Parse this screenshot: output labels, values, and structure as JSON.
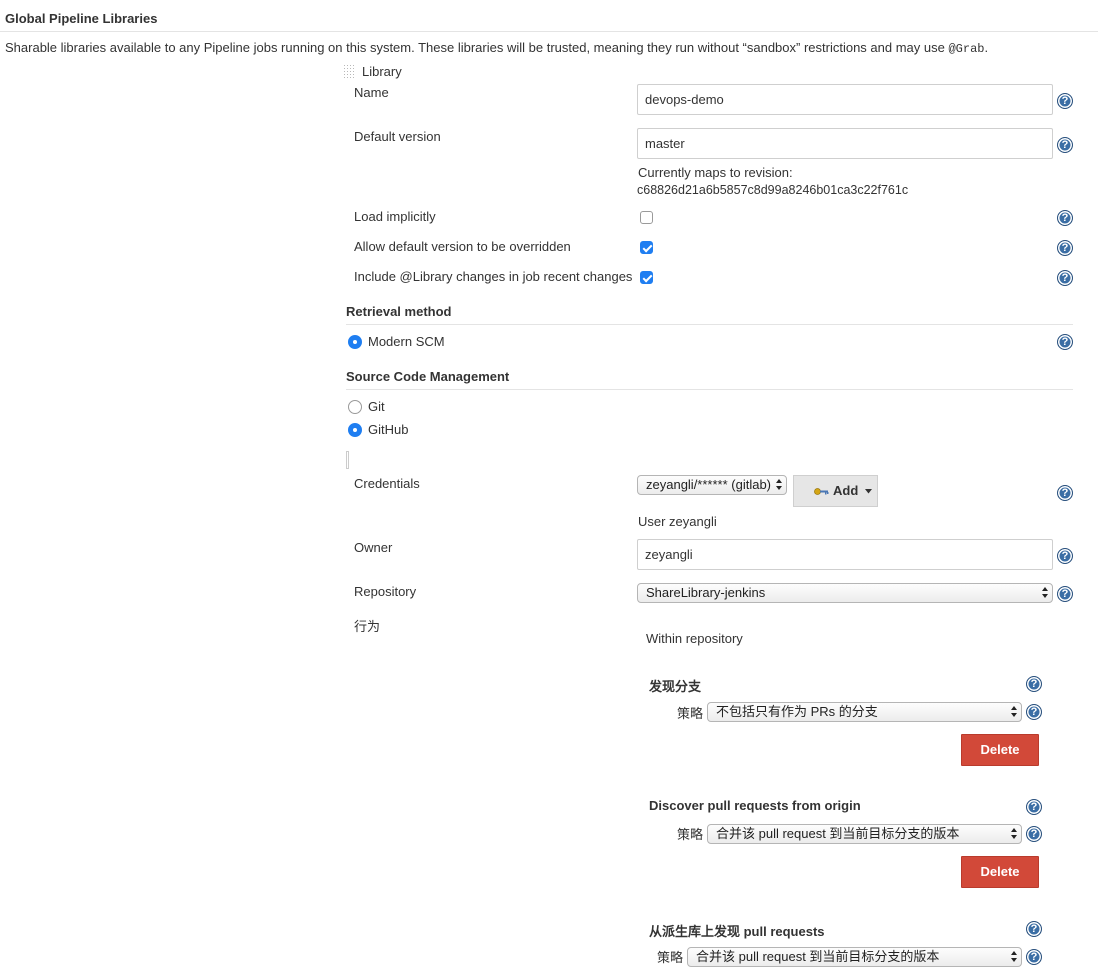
{
  "header": {
    "title": "Global Pipeline Libraries",
    "description_main": "Sharable libraries available to any Pipeline jobs running on this system. These libraries will be trusted, meaning they run without “sandbox” restrictions and may use ",
    "description_code": "@Grab",
    "description_end": "."
  },
  "library": {
    "header_label": "Library",
    "name": {
      "label": "Name",
      "value": "devops-demo"
    },
    "default_version": {
      "label": "Default version",
      "value": "master",
      "revision_label": "Currently maps to revision:",
      "revision": "c68826d21a6b5857c8d99a8246b01ca3c22f761c"
    },
    "load_implicitly": {
      "label": "Load implicitly",
      "checked": false
    },
    "allow_override": {
      "label": "Allow default version to be overridden",
      "checked": true
    },
    "include_changes": {
      "label": "Include @Library changes in job recent changes",
      "checked": true
    }
  },
  "retrieval": {
    "title": "Retrieval method",
    "option": "Modern SCM"
  },
  "scm": {
    "title": "Source Code Management",
    "git": "Git",
    "github": "GitHub",
    "credentials": {
      "label": "Credentials",
      "selected": "zeyangli/****** (gitlab)",
      "add_label": "Add",
      "user_text": "User zeyangli"
    },
    "owner": {
      "label": "Owner",
      "value": "zeyangli"
    },
    "repository": {
      "label": "Repository",
      "selected": "ShareLibrary-jenkins"
    },
    "behaviors": {
      "label": "行为",
      "within": "Within repository",
      "items": [
        {
          "title": "发现分支",
          "strategy_label": "策略",
          "strategy": "不包括只有作为 PRs 的分支",
          "delete": "Delete"
        },
        {
          "title": "Discover pull requests from origin",
          "strategy_label": "策略",
          "strategy": "合并该 pull request 到当前目标分支的版本",
          "delete": "Delete"
        },
        {
          "title": "从派生库上发现 pull requests",
          "strategy_label": "策略",
          "strategy": "合并该 pull request 到当前目标分支的版本"
        }
      ]
    }
  },
  "help_label": "?",
  "colors": {
    "accent": "#1f7ef1",
    "help": "#3b6ea5",
    "delete": "#d24939"
  }
}
